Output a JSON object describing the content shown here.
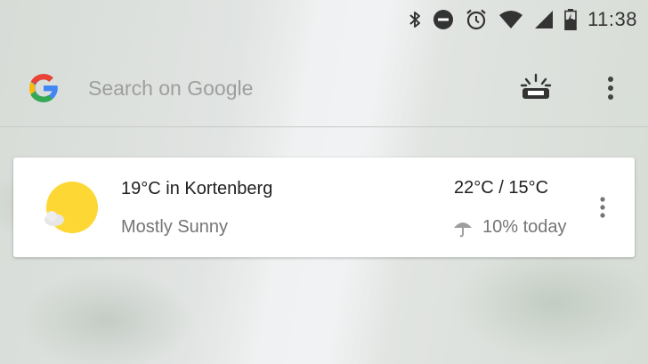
{
  "status_bar": {
    "time": "11:38",
    "icons": [
      "bluetooth-icon",
      "do-not-disturb-icon",
      "alarm-icon",
      "wifi-icon",
      "cell-signal-icon",
      "battery-charging-icon"
    ]
  },
  "search": {
    "placeholder": "Search on Google",
    "logo": "google-g-logo",
    "right_icons": [
      "night-light-icon",
      "overflow-menu-icon"
    ]
  },
  "weather_card": {
    "title": "19°C in Kortenberg",
    "condition": "Mostly Sunny",
    "temp_range": "22°C / 15°C",
    "precipitation": "10% today",
    "icons": [
      "mostly-sunny-icon",
      "umbrella-icon",
      "overflow-menu-icon"
    ]
  },
  "colors": {
    "sun": "#FDD835",
    "text_primary": "#212121",
    "text_secondary": "#757575",
    "placeholder": "#9e9e9e"
  }
}
